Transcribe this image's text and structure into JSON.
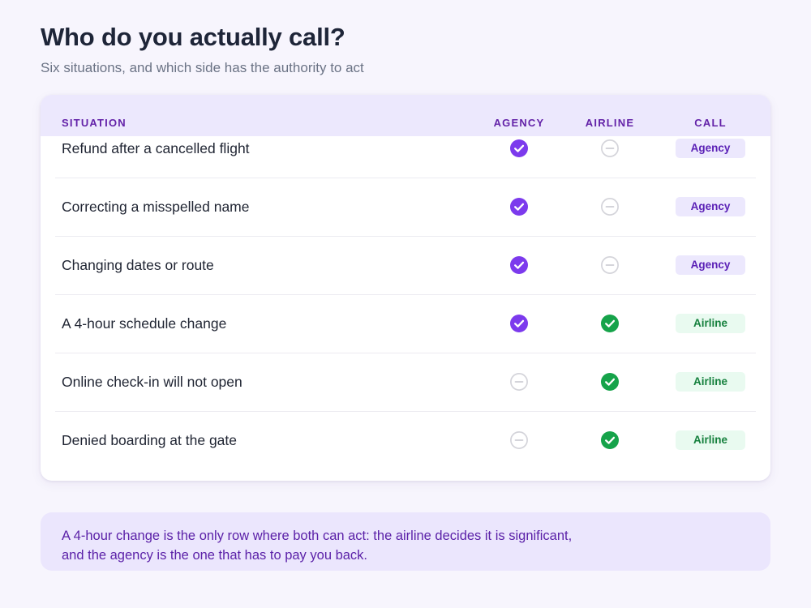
{
  "title": "Who do you actually call?",
  "subtitle": "Six situations, and which side has the authority to act",
  "table": {
    "headers": {
      "situation": "SITUATION",
      "agency": "AGENCY",
      "airline": "AIRLINE",
      "call": "CALL"
    },
    "rows": [
      {
        "situation": "Refund after a cancelled flight",
        "agency": "check-icon",
        "airline": "dash-icon",
        "call": "Agency"
      },
      {
        "situation": "Correcting a misspelled name",
        "agency": "check-icon",
        "airline": "dash-icon",
        "call": "Agency"
      },
      {
        "situation": "Changing dates or route",
        "agency": "check-icon",
        "airline": "dash-icon",
        "call": "Agency"
      },
      {
        "situation": "A 4-hour schedule change",
        "agency": "check-icon",
        "airline": "check-icon",
        "call": "Airline"
      },
      {
        "situation": "Online check-in will not open",
        "agency": "dash-icon",
        "airline": "check-icon",
        "call": "Airline"
      },
      {
        "situation": "Denied boarding at the gate",
        "agency": "dash-icon",
        "airline": "check-icon",
        "call": "Airline"
      }
    ]
  },
  "note": {
    "line1": "A 4-hour change is the only row where both can act: the airline decides it is significant,",
    "line2": "and the agency is the one that has to pay you back."
  },
  "colors": {
    "agency_accent": "#7c3aed",
    "airline_accent": "#16a34a",
    "neutral_icon": "#d4d4da"
  }
}
